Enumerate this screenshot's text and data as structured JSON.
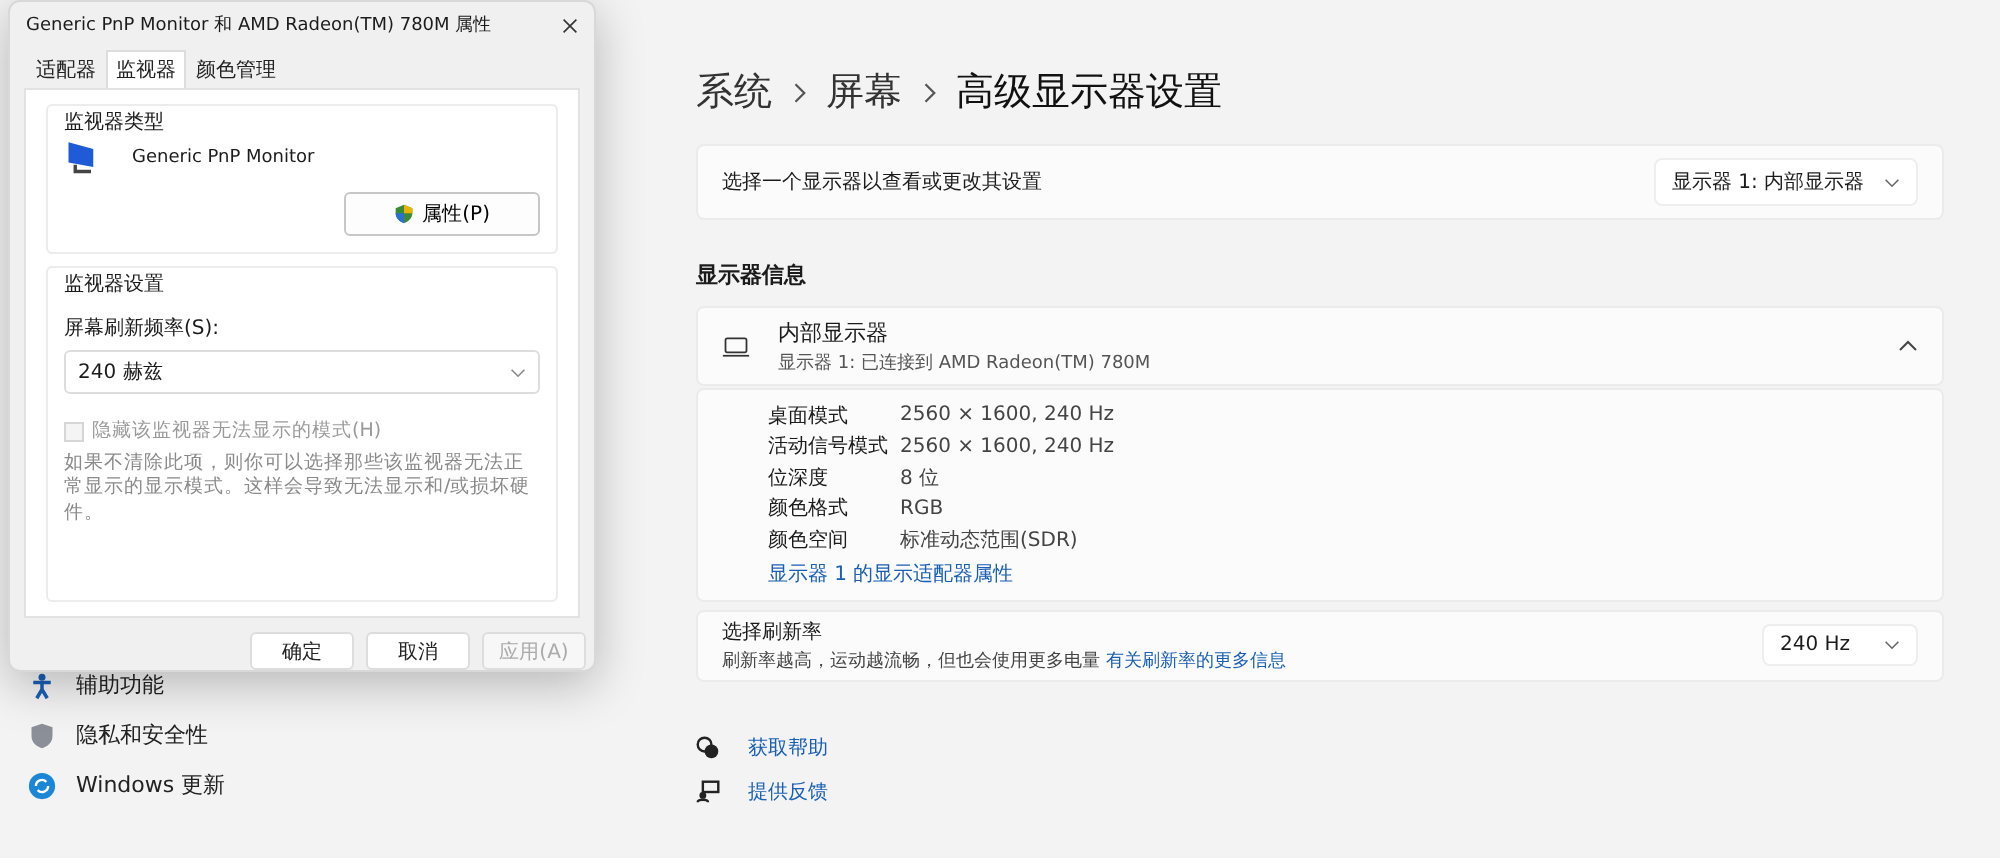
{
  "sidebar": {
    "items": [
      {
        "label": "辅助功能",
        "kind": "accessibility"
      },
      {
        "label": "隐私和安全性",
        "kind": "privacy"
      },
      {
        "label": "Windows 更新",
        "kind": "update"
      }
    ]
  },
  "settings": {
    "breadcrumb": [
      "系统",
      "屏幕",
      "高级显示器设置"
    ],
    "select_display": {
      "label": "选择一个显示器以查看或更改其设置",
      "value": "显示器 1: 内部显示器"
    },
    "section_title": "显示器信息",
    "display": {
      "name": "内部显示器",
      "subtitle": "显示器 1: 已连接到 AMD Radeon(TM) 780M",
      "expanded": true,
      "details": [
        {
          "label": "桌面模式",
          "value": "2560 × 1600, 240 Hz"
        },
        {
          "label": "活动信号模式",
          "value": "2560 × 1600, 240 Hz"
        },
        {
          "label": "位深度",
          "value": "8 位"
        },
        {
          "label": "颜色格式",
          "value": "RGB"
        },
        {
          "label": "颜色空间",
          "value": "标准动态范围(SDR)"
        }
      ],
      "link": "显示器 1 的显示适配器属性"
    },
    "refresh": {
      "title": "选择刷新率",
      "description": "刷新率越高，运动越流畅，但也会使用更多电量",
      "link": "有关刷新率的更多信息",
      "value": "240 Hz"
    },
    "help_links": [
      {
        "label": "获取帮助",
        "kind": "help"
      },
      {
        "label": "提供反馈",
        "kind": "feedback"
      }
    ]
  },
  "dialog": {
    "title": "Generic PnP Monitor 和 AMD Radeon(TM) 780M 属性",
    "tabs": [
      {
        "label": "适配器",
        "selected": false
      },
      {
        "label": "监视器",
        "selected": true
      },
      {
        "label": "颜色管理",
        "selected": false
      }
    ],
    "monitor_type": {
      "heading": "监视器类型",
      "name": "Generic PnP Monitor",
      "button": "属性(P)"
    },
    "monitor_settings": {
      "heading": "监视器设置",
      "refresh_label": "屏幕刷新频率(S):",
      "refresh_value": "240 赫兹",
      "hide_modes": {
        "label": "隐藏该监视器无法显示的模式(H)",
        "checked": false,
        "disabled": true
      },
      "note": "如果不清除此项，则你可以选择那些该监视器无法正常显示的显示模式。这样会导致无法显示和/或损坏硬件。"
    },
    "buttons": [
      {
        "label": "确定",
        "disabled": false
      },
      {
        "label": "取消",
        "disabled": false
      },
      {
        "label": "应用(A)",
        "disabled": true
      }
    ]
  }
}
